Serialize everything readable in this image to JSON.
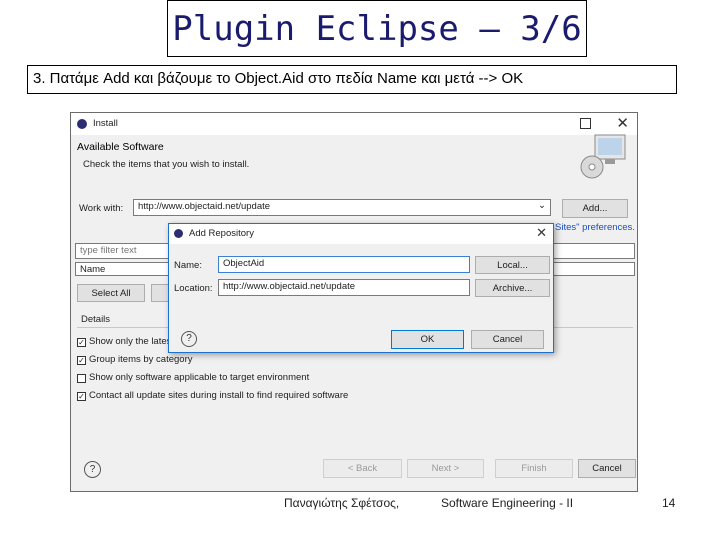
{
  "slide": {
    "title": "Plugin Eclipse – 3/6",
    "instruction": "3. Πατάμε Add και βάζουμε το Object.Aid στο πεδία Name και μετά --> OK",
    "footer_author": "Παναγιώτης Σφέτσος,",
    "footer_course": "Software Engineering - II",
    "page_number": "14"
  },
  "install_window": {
    "title": "Install",
    "heading": "Available Software",
    "subheading": "Check the items that you wish to install.",
    "work_with_label": "Work with:",
    "work_with_value": "http://www.objectaid.net/update",
    "add_button": "Add...",
    "preferences_link": "Sites\" preferences.",
    "filter_placeholder": "type filter text",
    "column_name": "Name",
    "select_all_button": "Select All",
    "details_label": "Details",
    "options": [
      {
        "label": "Show only the latest versions of available software",
        "checked": true
      },
      {
        "label": "Group items by category",
        "checked": true
      },
      {
        "label": "Show only software applicable to target environment",
        "checked": false
      },
      {
        "label": "Contact all update sites during install to find required software",
        "checked": true
      }
    ],
    "back_button": "< Back",
    "next_button": "Next >",
    "finish_button": "Finish",
    "cancel_button": "Cancel"
  },
  "add_repository_dialog": {
    "title": "Add Repository",
    "name_label": "Name:",
    "name_value": "ObjectAid",
    "location_label": "Location:",
    "location_value": "http://www.objectaid.net/update",
    "local_button": "Local...",
    "archive_button": "Archive...",
    "ok_button": "OK",
    "cancel_button": "Cancel"
  }
}
